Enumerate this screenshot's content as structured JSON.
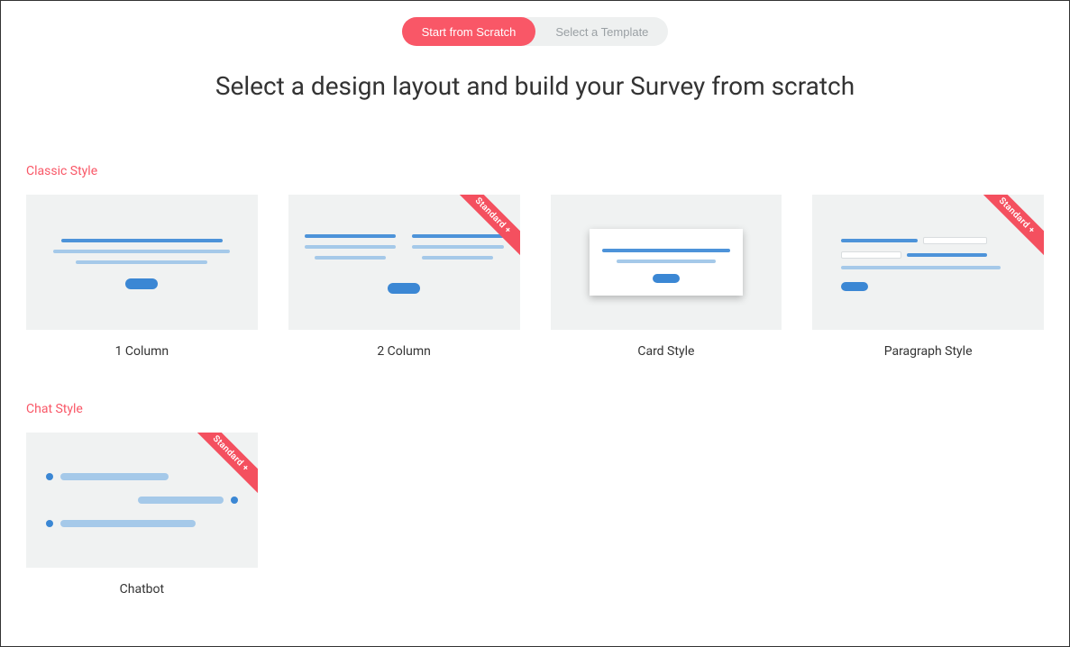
{
  "toggle": {
    "scratch_label": "Start from Scratch",
    "template_label": "Select a Template"
  },
  "page_title": "Select a design layout and build your Survey from scratch",
  "sections": {
    "classic": {
      "title": "Classic Style",
      "options": {
        "one_column": {
          "label": "1 Column"
        },
        "two_column": {
          "label": "2 Column",
          "ribbon": "Standard +"
        },
        "card_style": {
          "label": "Card Style"
        },
        "paragraph": {
          "label": "Paragraph Style",
          "ribbon": "Standard +"
        }
      }
    },
    "chat": {
      "title": "Chat Style",
      "options": {
        "chatbot": {
          "label": "Chatbot",
          "ribbon": "Standard +"
        }
      }
    }
  }
}
